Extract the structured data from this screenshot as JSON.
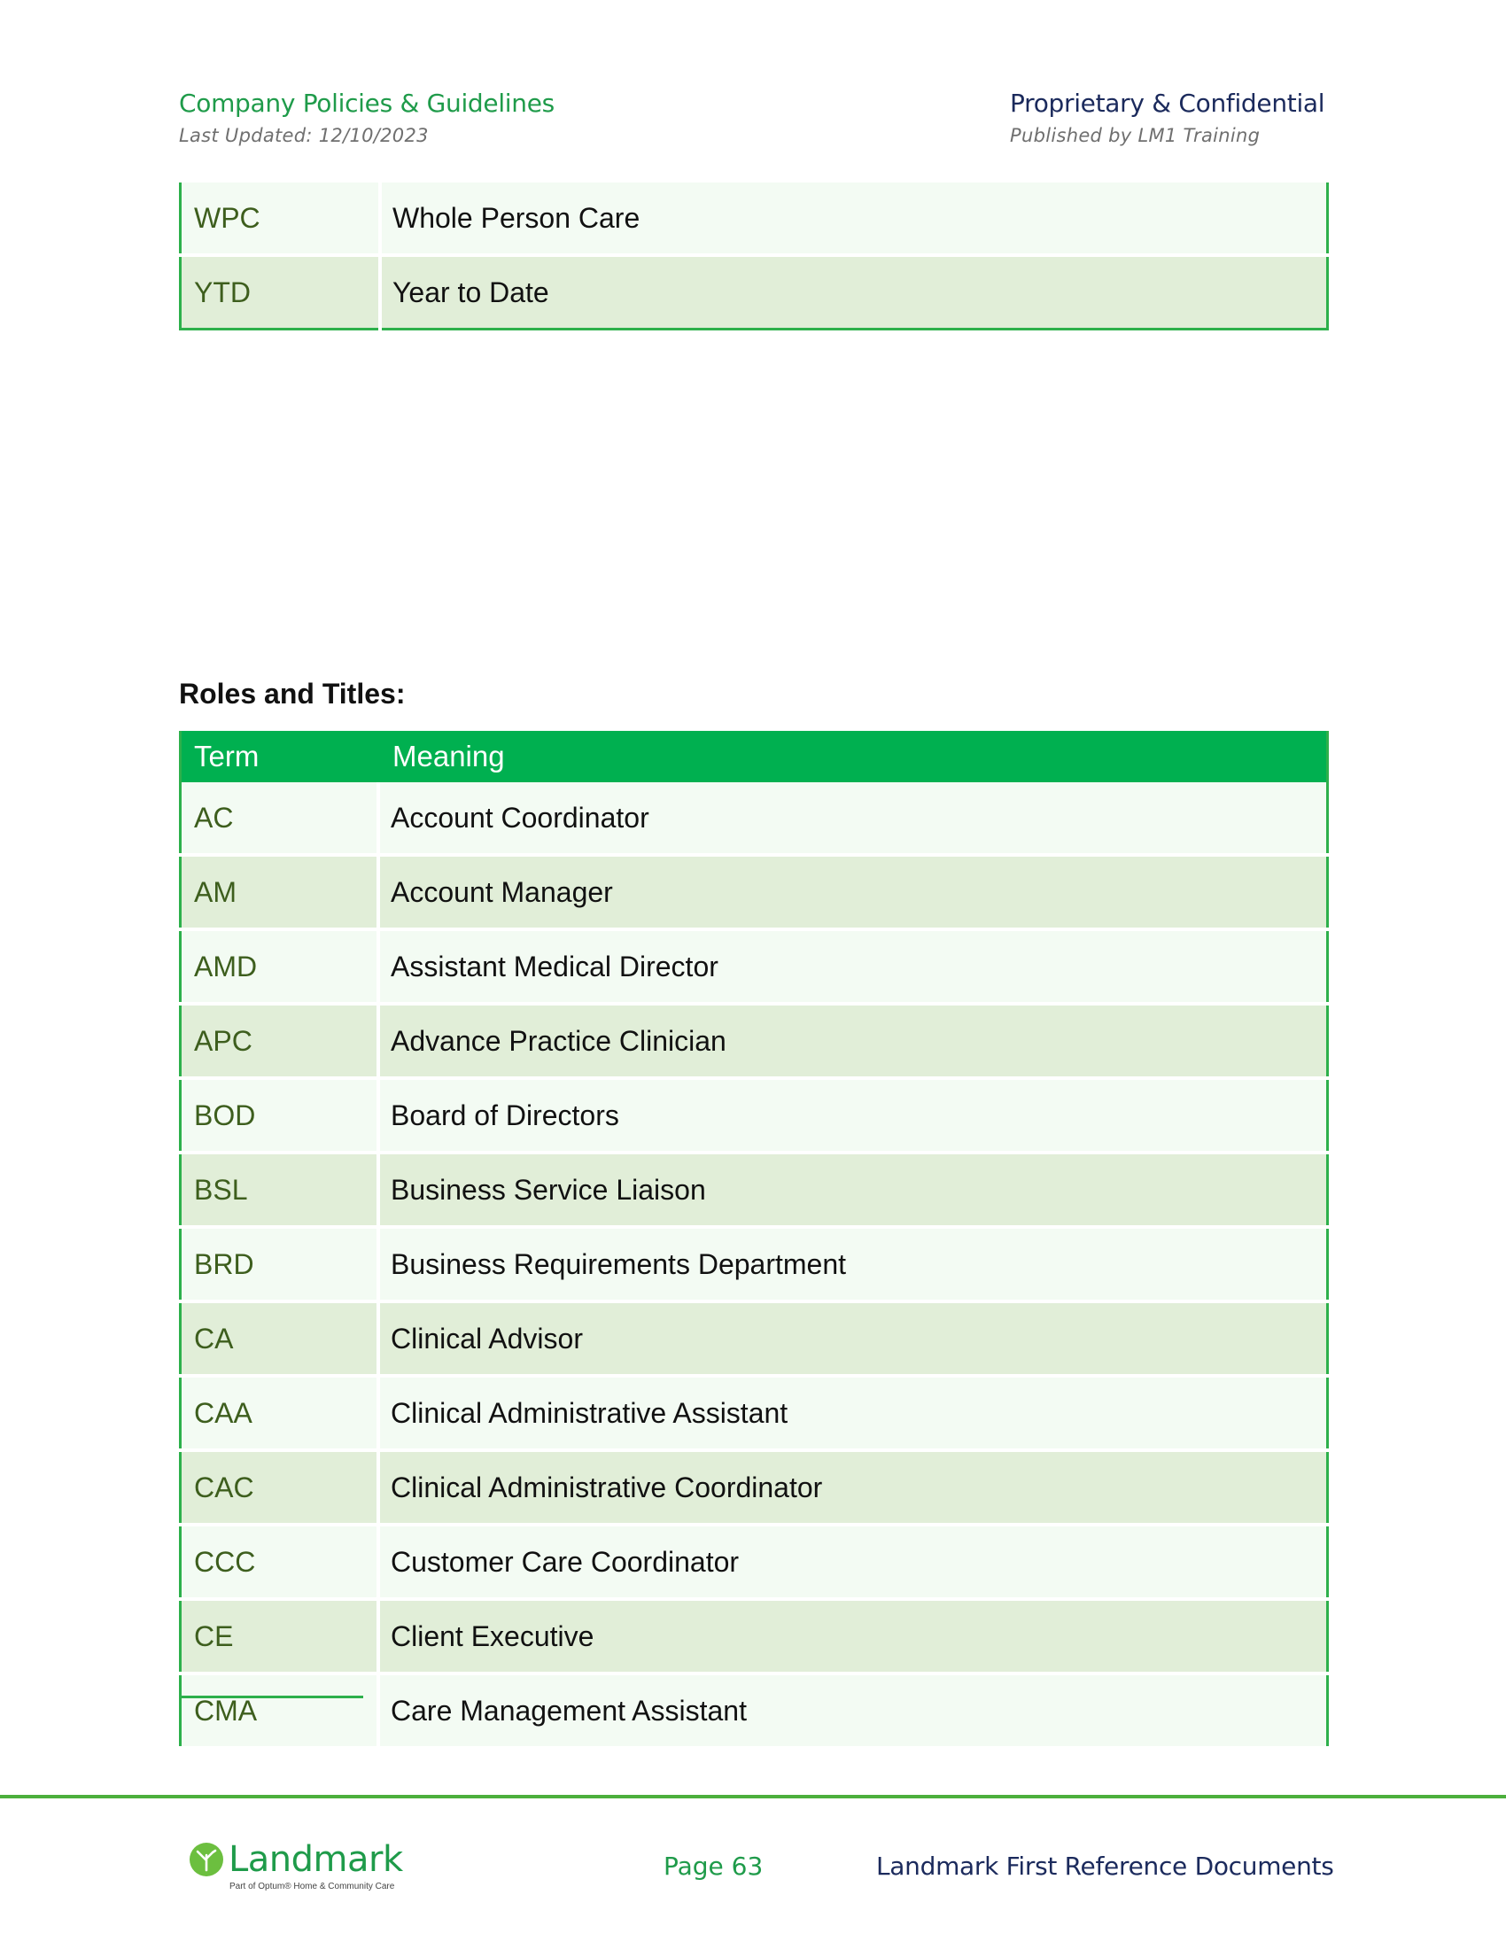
{
  "header": {
    "left_title": "Company Policies & Guidelines",
    "left_sub": "Last Updated: 12/10/2023",
    "right_title": "Proprietary & Confidential",
    "right_sub": "Published by LM1 Training"
  },
  "table_continued": {
    "rows": [
      {
        "term": "WPC",
        "meaning": "Whole Person Care"
      },
      {
        "term": "YTD",
        "meaning": "Year to Date"
      }
    ]
  },
  "roles": {
    "title": "Roles and Titles:",
    "headers": {
      "term": "Term",
      "meaning": "Meaning"
    },
    "rows": [
      {
        "term": "AC",
        "meaning": "Account Coordinator"
      },
      {
        "term": "AM",
        "meaning": "Account Manager"
      },
      {
        "term": "AMD",
        "meaning": "Assistant Medical Director"
      },
      {
        "term": "APC",
        "meaning": "Advance Practice Clinician"
      },
      {
        "term": "BOD",
        "meaning": "Board of Directors"
      },
      {
        "term": "BSL",
        "meaning": "Business Service Liaison"
      },
      {
        "term": "BRD",
        "meaning": "Business Requirements Department"
      },
      {
        "term": "CA",
        "meaning": "Clinical Advisor"
      },
      {
        "term": "CAA",
        "meaning": "Clinical Administrative Assistant"
      },
      {
        "term": "CAC",
        "meaning": "Clinical Administrative Coordinator"
      },
      {
        "term": "CCC",
        "meaning": "Customer Care Coordinator"
      },
      {
        "term": "CE",
        "meaning": "Client Executive"
      },
      {
        "term": "CMA",
        "meaning": "Care Management Assistant"
      }
    ]
  },
  "footer": {
    "logo_text": "Landmark",
    "logo_tagline": "Part of Optum® Home & Community Care",
    "page": "Page 63",
    "doc_title": "Landmark First Reference Documents"
  },
  "colors": {
    "accent_green": "#00b050",
    "header_green": "#1f9b4a",
    "navy": "#1b2a5c",
    "row_light": "#f3fbf3",
    "row_dark": "#e1eed8"
  },
  "icons": [
    "landmark-tree-logo-icon"
  ]
}
